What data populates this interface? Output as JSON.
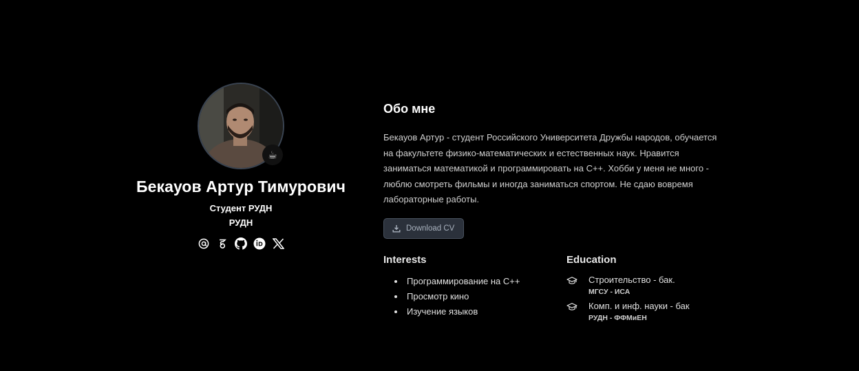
{
  "profile": {
    "name": "Бекауов Артур Тимурович",
    "role": "Студент РУДН",
    "organization": "РУДН",
    "badge_emoji": "☕",
    "social_links": [
      {
        "icon": "at-sign-icon"
      },
      {
        "icon": "google-scholar-icon"
      },
      {
        "icon": "github-icon"
      },
      {
        "icon": "orcid-icon"
      },
      {
        "icon": "x-twitter-icon"
      }
    ]
  },
  "about": {
    "title": "Обо мне",
    "text_lines": [
      "Бекауов Артур - студент Российского Университета Дружбы народов, обучается",
      "на факультете физико-математических и естественных наук. Нравится",
      "заниматься математикой и программировать на С++. Хобби у меня не много -",
      "люблю смотреть фильмы и иногда заниматься спортом. Не сдаю вовремя",
      "лабораторные работы."
    ],
    "cv_button_label": "Download CV"
  },
  "interests": {
    "title": "Interests",
    "items": [
      "Программирование на С++",
      "Просмотр кино",
      "Изучение языков"
    ]
  },
  "education": {
    "title": "Education",
    "items": [
      {
        "degree": "Строительство - бак.",
        "school": "МГСУ - ИСА"
      },
      {
        "degree": "Комп. и инф. науки - бак",
        "school": "РУДН - ФФМиЕН"
      }
    ]
  },
  "colors": {
    "background": "#000000",
    "button_bg": "#2b313b",
    "button_border": "#48515e",
    "avatar_border": "#3a4452"
  }
}
